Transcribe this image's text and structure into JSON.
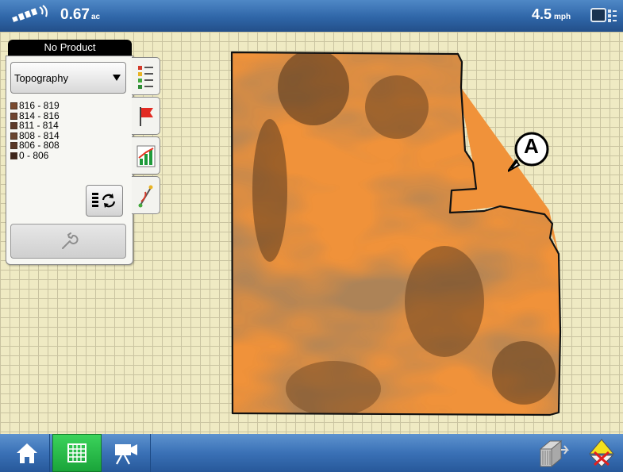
{
  "topbar": {
    "area_value": "0.67",
    "area_unit": "ac",
    "speed_value": "4.5",
    "speed_unit": "mph",
    "gps_icon": "gps-satellite-icon",
    "monitor_icon": "display-monitor-icon"
  },
  "panel": {
    "product_tab": "No Product",
    "dropdown_value": "Topography",
    "legend": [
      {
        "label": "816 - 819",
        "color": "#7a4a2e"
      },
      {
        "label": "814 - 816",
        "color": "#6f4430"
      },
      {
        "label": "811 - 814",
        "color": "#5e3a29"
      },
      {
        "label": "808 - 814",
        "color": "#6a4530"
      },
      {
        "label": "806 - 808",
        "color": "#5a3826"
      },
      {
        "label": "0 - 806",
        "color": "#3e261a"
      }
    ]
  },
  "side_tabs": [
    "legend-icon",
    "flag-icon",
    "bar-chart-icon",
    "guidance-line-icon"
  ],
  "map": {
    "field_marker": "A",
    "colors": {
      "grid_bg": "#efeac3",
      "field_base": "#f0923a",
      "field_dark": "#5c3a1c"
    }
  },
  "bottombar": {
    "buttons": [
      "home-icon",
      "map-grid-icon",
      "video-camera-icon",
      "implement-icon",
      "alert-icon"
    ]
  }
}
